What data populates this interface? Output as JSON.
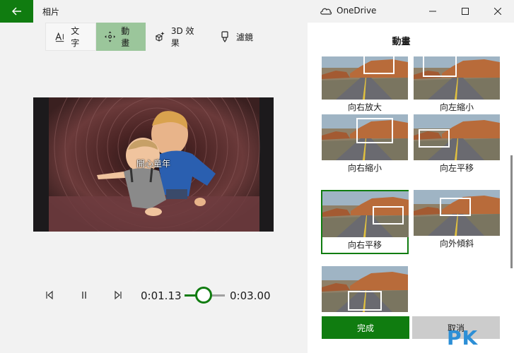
{
  "app": {
    "title": "相片",
    "onedrive_label": "OneDrive"
  },
  "toolbar": {
    "text_label": "文字",
    "motion_label": "動畫",
    "effects_label": "3D 效果",
    "filters_label": "濾鏡"
  },
  "preview": {
    "caption": "開心童年"
  },
  "playback": {
    "current_time": "0:01.13",
    "total_time": "0:03.00",
    "progress": 0.47
  },
  "panel": {
    "title": "動畫",
    "items": [
      {
        "label": "向右放大",
        "selected": false
      },
      {
        "label": "向左縮小",
        "selected": false
      },
      {
        "label": "向右縮小",
        "selected": false
      },
      {
        "label": "向左平移",
        "selected": false
      },
      {
        "label": "向右平移",
        "selected": true
      },
      {
        "label": "向外傾斜",
        "selected": false
      },
      {
        "label": "",
        "selected": false
      }
    ]
  },
  "buttons": {
    "done": "完成",
    "cancel": "取消"
  },
  "watermark": "PK",
  "colors": {
    "accent": "#107c10",
    "selected_tool": "#9bc69b"
  }
}
